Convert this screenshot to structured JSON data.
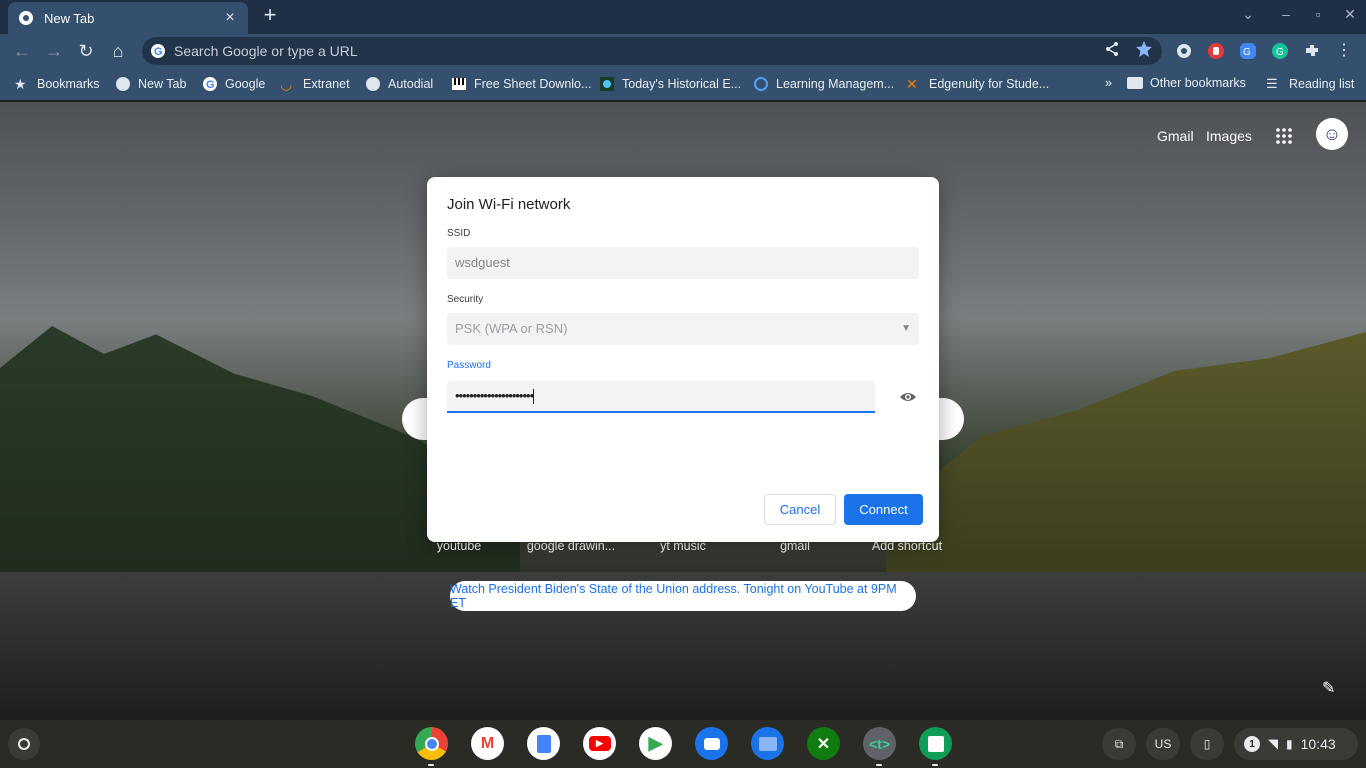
{
  "browser": {
    "tab_title": "New Tab",
    "tab_close": "×",
    "new_tab": "+",
    "omnibox_placeholder": "Search Google or type a URL",
    "bookmarks": [
      {
        "label": "Bookmarks",
        "icon": "star-icon"
      },
      {
        "label": "New Tab",
        "icon": "globe-icon"
      },
      {
        "label": "Google",
        "icon": "google-icon"
      },
      {
        "label": "Extranet",
        "icon": "extranet-icon"
      },
      {
        "label": "Autodial",
        "icon": "globe-icon"
      },
      {
        "label": "Free Sheet Downlo...",
        "icon": "piano-icon"
      },
      {
        "label": "Today's Historical E...",
        "icon": "history-icon"
      },
      {
        "label": "Learning Managem...",
        "icon": "circle-icon"
      },
      {
        "label": "Edgenuity for Stude...",
        "icon": "edgenuity-icon"
      }
    ],
    "overflow_chevron": "»",
    "other_bookmarks": "Other bookmarks",
    "reading_list": "Reading list"
  },
  "newtab": {
    "gmail_link": "Gmail",
    "images_link": "Images",
    "shortcuts": [
      "youtube",
      "google drawin...",
      "yt music",
      "gmail",
      "Add shortcut"
    ],
    "promo": "Watch President Biden's State of the Union address. Tonight on YouTube at 9PM ET"
  },
  "dialog": {
    "title": "Join Wi-Fi network",
    "ssid_label": "SSID",
    "ssid_value": "wsdguest",
    "security_label": "Security",
    "security_value": "PSK (WPA or RSN)",
    "password_label": "Password",
    "password_value": "••••••••••••••••••••••",
    "cancel": "Cancel",
    "connect": "Connect"
  },
  "shelf": {
    "apps": [
      "Chrome",
      "Gmail",
      "Docs",
      "YouTube",
      "Play Store",
      "Messages",
      "Files",
      "Xbox",
      "t",
      "Sheets"
    ],
    "ime": "US",
    "notification_count": "1",
    "time": "10:43"
  },
  "colors": {
    "accent": "#1a73e8",
    "chrome_frame": "#35506e",
    "shelf": "#2b2b26"
  }
}
